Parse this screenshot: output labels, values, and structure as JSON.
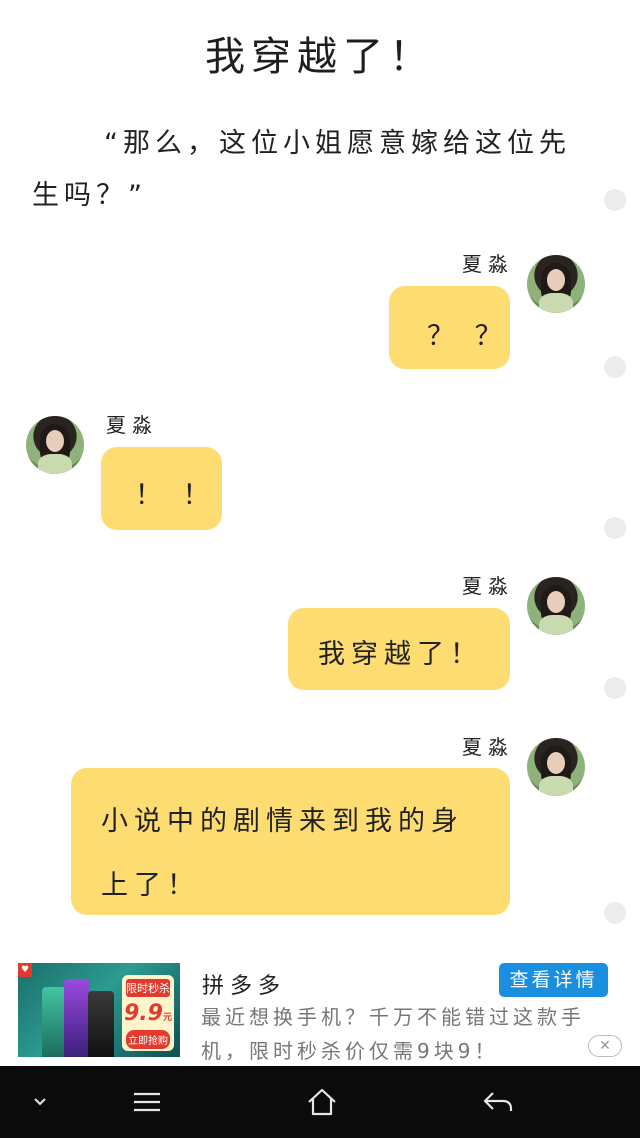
{
  "chapter": {
    "title": "我穿越了！"
  },
  "narration": {
    "text": "“那么，这位小姐愿意嫁给这位先生吗？”"
  },
  "messages": [
    {
      "side": "right",
      "sender": "夏淼",
      "lines": [
        "？ ？"
      ]
    },
    {
      "side": "left",
      "sender": "夏淼",
      "lines": [
        "！ ！"
      ]
    },
    {
      "side": "right",
      "sender": "夏淼",
      "lines": [
        "我穿越了！"
      ]
    },
    {
      "side": "right",
      "sender": "夏淼",
      "lines": [
        "小说中的剧情来到我的身",
        "上了！"
      ]
    }
  ],
  "ad": {
    "advertiser": "拼多多",
    "cta_label": "查看详情",
    "description": "最近想换手机？千万不能错过这款手机，限时秒杀价仅需9块9！",
    "image": {
      "badge_top": "限时秒杀",
      "badge_price": "9.9",
      "badge_unit": "元",
      "badge_button": "立即抢购"
    },
    "close_icon": "close-icon"
  },
  "navbar": {
    "icons": [
      "chevron-down-icon",
      "menu-icon",
      "home-icon",
      "back-icon"
    ]
  },
  "colors": {
    "bubble": "#fddc72",
    "cta": "#1a8fe0",
    "navbar": "#0b0b0b"
  }
}
